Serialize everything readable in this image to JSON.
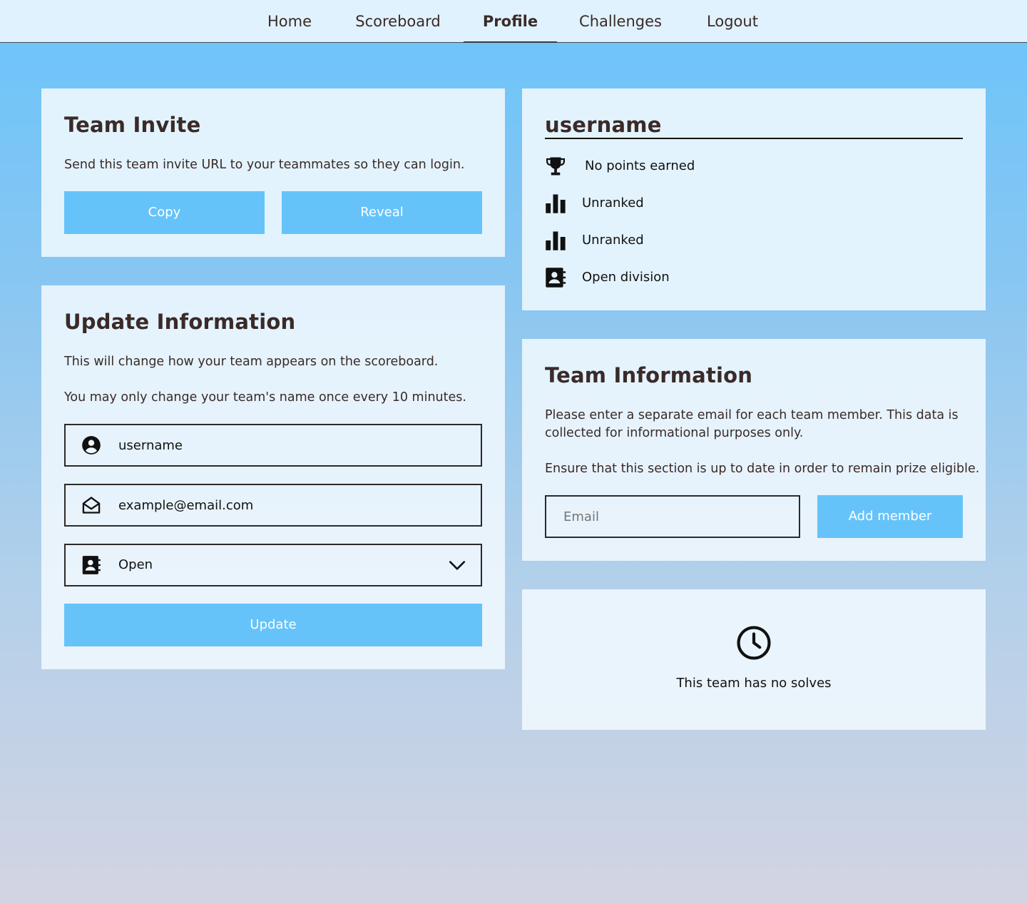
{
  "nav": {
    "items": [
      {
        "label": "Home"
      },
      {
        "label": "Scoreboard"
      },
      {
        "label": "Profile"
      },
      {
        "label": "Challenges"
      },
      {
        "label": "Logout"
      }
    ],
    "active": "Profile"
  },
  "team_invite": {
    "title": "Team Invite",
    "description": "Send this team invite URL to your teammates so they can login.",
    "copy_label": "Copy",
    "reveal_label": "Reveal"
  },
  "update_info": {
    "title": "Update Information",
    "description1": "This will change how your team appears on the scoreboard.",
    "description2": "You may only change your team's name once every 10 minutes.",
    "name_value": "username",
    "email_value": "example@email.com",
    "division_value": "Open",
    "update_label": "Update"
  },
  "profile": {
    "username": "username",
    "stats": [
      {
        "icon": "trophy-icon",
        "text": "No points earned"
      },
      {
        "icon": "bar-chart-icon",
        "text": "Unranked"
      },
      {
        "icon": "bar-chart-icon",
        "text": "Unranked"
      },
      {
        "icon": "contact-card-icon",
        "text": "Open division"
      }
    ]
  },
  "team_info": {
    "title": "Team Information",
    "description1": "Please enter a separate email for each team member. This data is collected for informational purposes only.",
    "description2": "Ensure that this section is up to date in order to remain prize eligible.",
    "email_placeholder": "Email",
    "add_member_label": "Add member"
  },
  "solves": {
    "empty_text": "This team has no solves"
  },
  "colors": {
    "accent": "#65c3fa",
    "nav_bg": "#e0f2fe",
    "text": "#3a2a28"
  }
}
